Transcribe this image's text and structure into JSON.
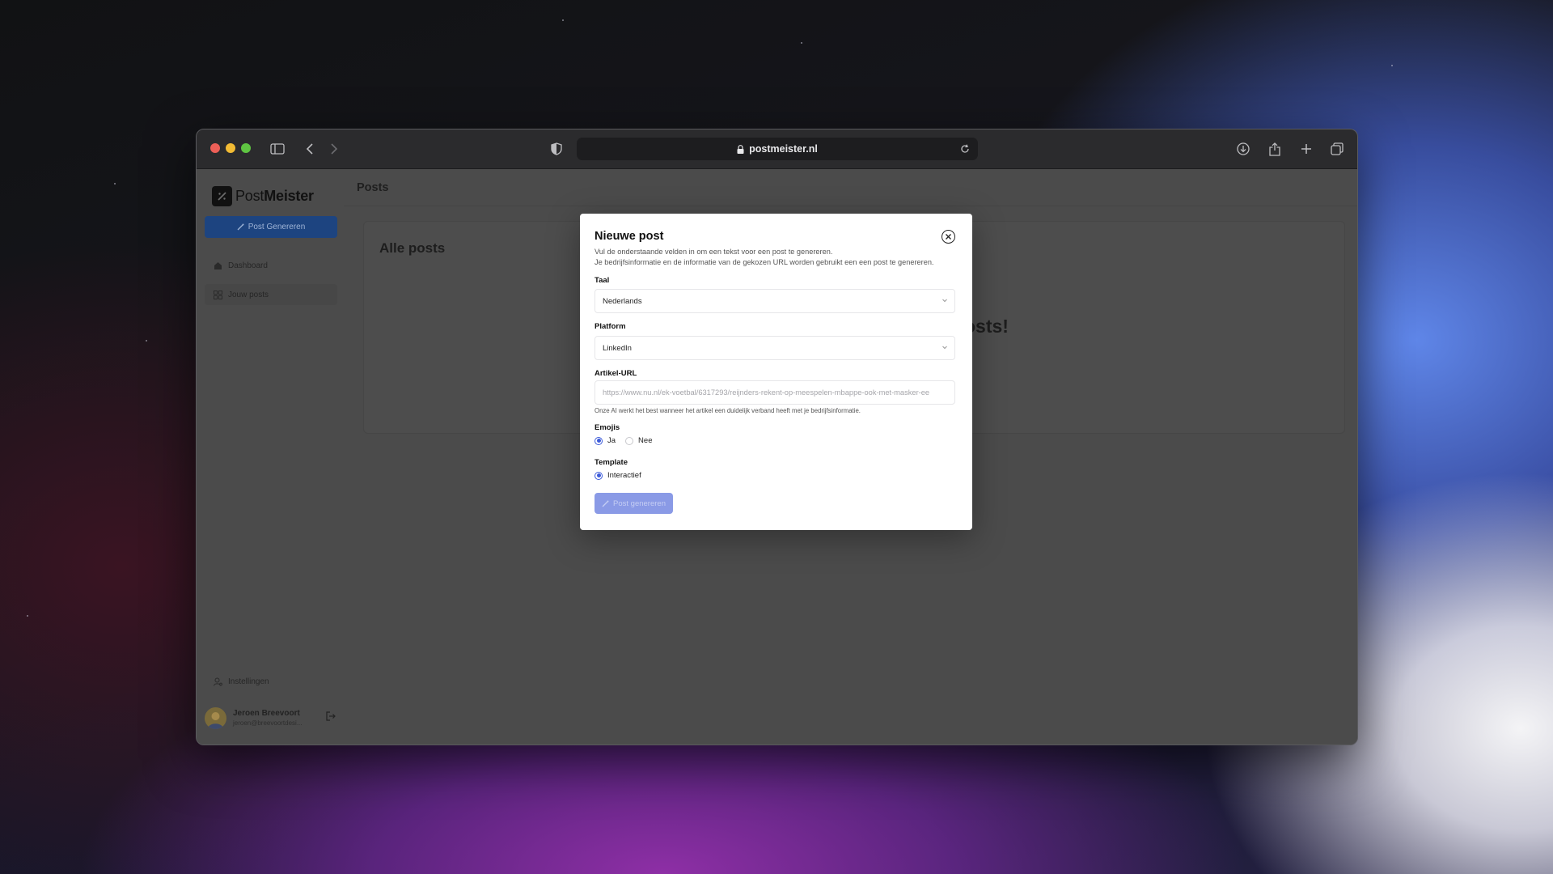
{
  "browser": {
    "url": "postmeister.nl",
    "colors": {
      "close": "#ec5f57",
      "minimize": "#f2bb34",
      "zoom": "#5fc542"
    }
  },
  "app": {
    "logo": {
      "light": "Post",
      "bold": "Meister"
    },
    "sidebar": {
      "generate_button": "Post Genereren",
      "items": [
        {
          "label": "Dashboard",
          "icon": "home-icon"
        },
        {
          "label": "Jouw posts",
          "icon": "grid-icon"
        }
      ],
      "settings": "Instellingen",
      "user": {
        "name": "Jeroen Breevoort",
        "email": "jeroen@breevoortdesi..."
      }
    },
    "header": {
      "title": "Posts"
    },
    "card": {
      "title": "Alle posts",
      "partial_text": "osts!"
    }
  },
  "modal": {
    "title": "Nieuwe post",
    "description_line1": "Vul de onderstaande velden in om een tekst voor een post te genereren.",
    "description_line2": "Je bedrijfsinformatie en de informatie van de gekozen URL worden gebruikt een een post te genereren.",
    "language": {
      "label": "Taal",
      "value": "Nederlands"
    },
    "platform": {
      "label": "Platform",
      "value": "LinkedIn"
    },
    "url": {
      "label": "Artikel-URL",
      "placeholder": "https://www.nu.nl/ek-voetbal/6317293/reijnders-rekent-op-meespelen-mbappe-ook-met-masker-ee",
      "hint": "Onze AI werkt het best wanneer het artikel een duidelijk verband heeft met je bedrijfsinformatie."
    },
    "emojis": {
      "label": "Emojis",
      "options": [
        "Ja",
        "Nee"
      ],
      "selected": "Ja"
    },
    "template": {
      "label": "Template",
      "options": [
        "Interactief"
      ],
      "selected": "Interactief"
    },
    "submit_label": "Post genereren",
    "accent": "#3d5bd9"
  }
}
